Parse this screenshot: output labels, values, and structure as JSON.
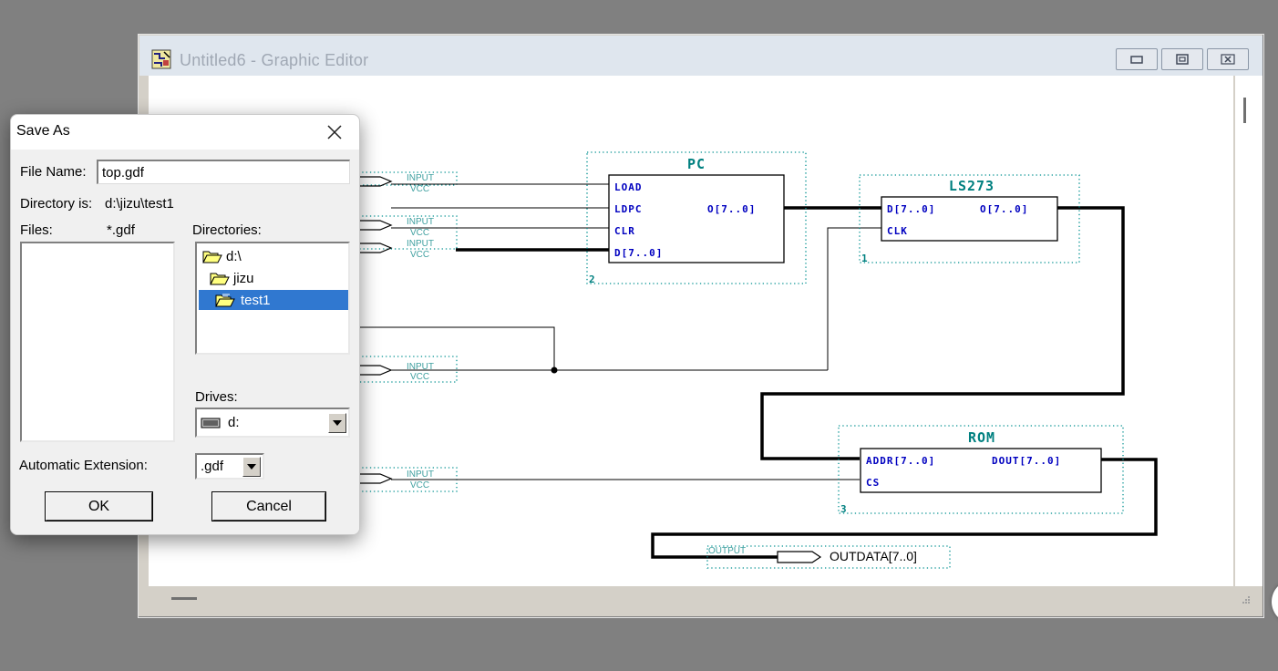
{
  "window": {
    "title": "Untitled6 - Graphic Editor",
    "icon": "graphic-editor-app-icon",
    "controls": {
      "minimize": "minimize-icon",
      "restore": "restore-icon",
      "close": "close-icon"
    }
  },
  "schematic": {
    "pins": [
      {
        "kind": "INPUT",
        "label": "VCC"
      },
      {
        "kind": "INPUT",
        "label": "VCC"
      },
      {
        "kind": "INPUT",
        "label": "VCC"
      },
      {
        "kind": "INPUT",
        "label": "VCC"
      },
      {
        "kind": "INPUT",
        "label": "VCC"
      }
    ],
    "output": {
      "kind": "OUTPUT",
      "label": "OUTDATA[7..0]"
    },
    "blocks": [
      {
        "name": "PC",
        "number": "2",
        "inputs": [
          "LOAD",
          "LDPC",
          "CLR",
          "D[7..0]"
        ],
        "outputs": [
          "O[7..0]"
        ]
      },
      {
        "name": "LS273",
        "number": "1",
        "inputs": [
          "D[7..0]",
          "CLK"
        ],
        "outputs": [
          "O[7..0]"
        ]
      },
      {
        "name": "ROM",
        "number": "3",
        "inputs": [
          "ADDR[7..0]",
          "CS"
        ],
        "outputs": [
          "DOUT[7..0]"
        ]
      }
    ]
  },
  "dialog": {
    "title": "Save As",
    "file_name_label": "File Name:",
    "file_name_value": "top.gdf",
    "directory_label": "Directory is:",
    "directory_value": "d:\\jizu\\test1",
    "files_label": "Files:",
    "files_filter": "*.gdf",
    "directories_label": "Directories:",
    "directories": [
      {
        "label": "d:\\",
        "selected": false,
        "icon": "open-folder-icon"
      },
      {
        "label": "jizu",
        "selected": false,
        "icon": "open-folder-icon"
      },
      {
        "label": "test1",
        "selected": true,
        "icon": "open-folder-icon"
      }
    ],
    "drives_label": "Drives:",
    "drive_value": "d:",
    "auto_ext_label": "Automatic Extension:",
    "auto_ext_value": ".gdf",
    "ok_label": "OK",
    "cancel_label": "Cancel"
  },
  "colors": {
    "block_text": "#0000c0",
    "block_title": "#008080",
    "pin_text": "#40a0a0",
    "selection": "#3078d0"
  }
}
